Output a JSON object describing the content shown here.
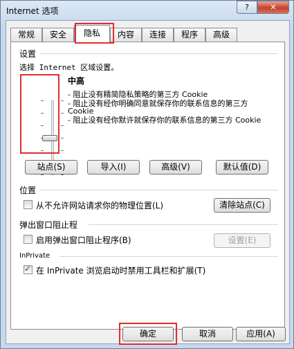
{
  "window": {
    "title": "Internet 选项",
    "help_label": "?",
    "close_label": "✕"
  },
  "tabs": [
    {
      "label": "常规"
    },
    {
      "label": "安全"
    },
    {
      "label": "隐私"
    },
    {
      "label": "内容"
    },
    {
      "label": "连接"
    },
    {
      "label": "程序"
    },
    {
      "label": "高级"
    }
  ],
  "settings": {
    "section_label": "设置",
    "zone_prompt": "选择 Internet 区域设置。",
    "level_title": "中高",
    "level_value": 0.5,
    "descriptions": [
      "- 阻止没有精简隐私策略的第三方 Cookie",
      "- 阻止没有经你明确同意就保存你的联系信息的第三方 Cookie",
      "- 阻止没有经你默许就保存你的联系信息的第三方 Cookie"
    ],
    "buttons": {
      "sites": "站点(S)",
      "import": "导入(I)",
      "advanced": "高级(V)",
      "default": "默认值(D)"
    }
  },
  "location": {
    "section_label": "位置",
    "checkbox_label": "从不允许网站请求你的物理位置(L)",
    "checked": false,
    "clear_button": "清除站点(C)"
  },
  "popup": {
    "section_label": "弹出窗口阻止程",
    "checkbox_label": "启用弹出窗口阻止程序(B)",
    "checked": false,
    "settings_button": "设置(E)"
  },
  "inprivate": {
    "section_label": "InPrivate",
    "checkbox_label": "在 InPrivate 浏览启动时禁用工具栏和扩展(T)",
    "checked": true
  },
  "footer": {
    "ok": "确定",
    "cancel": "取消",
    "apply": "应用(A)"
  }
}
